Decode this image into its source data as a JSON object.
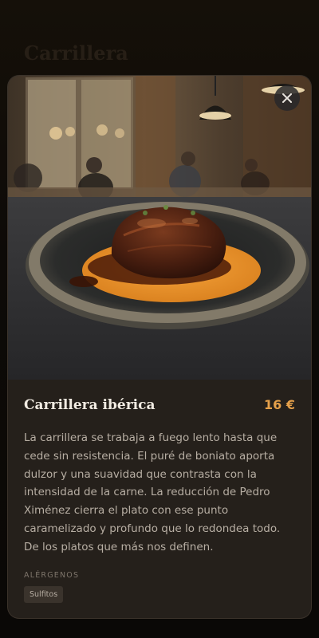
{
  "background": {
    "title": "Carrillera"
  },
  "dish": {
    "name": "Carrillera ibérica",
    "price": "16 €",
    "description": "La carrillera se trabaja a fuego lento hasta que cede sin resistencia. El puré de boniato aporta dulzor y una suavidad que contrasta con la intensidad de la carne. La reducción de Pedro Ximénez cierra el plato con ese punto caramelizado y profundo que lo redondea todo. De los platos que más nos definen.",
    "allergens_heading": "ALÉRGENOS",
    "allergens": [
      "Sulfitos"
    ]
  },
  "icons": {
    "close": "close-icon"
  },
  "colors": {
    "accent": "#e5a04a",
    "card": "#25201b",
    "text": "#f1ebe2",
    "muted": "#b7aea3"
  }
}
